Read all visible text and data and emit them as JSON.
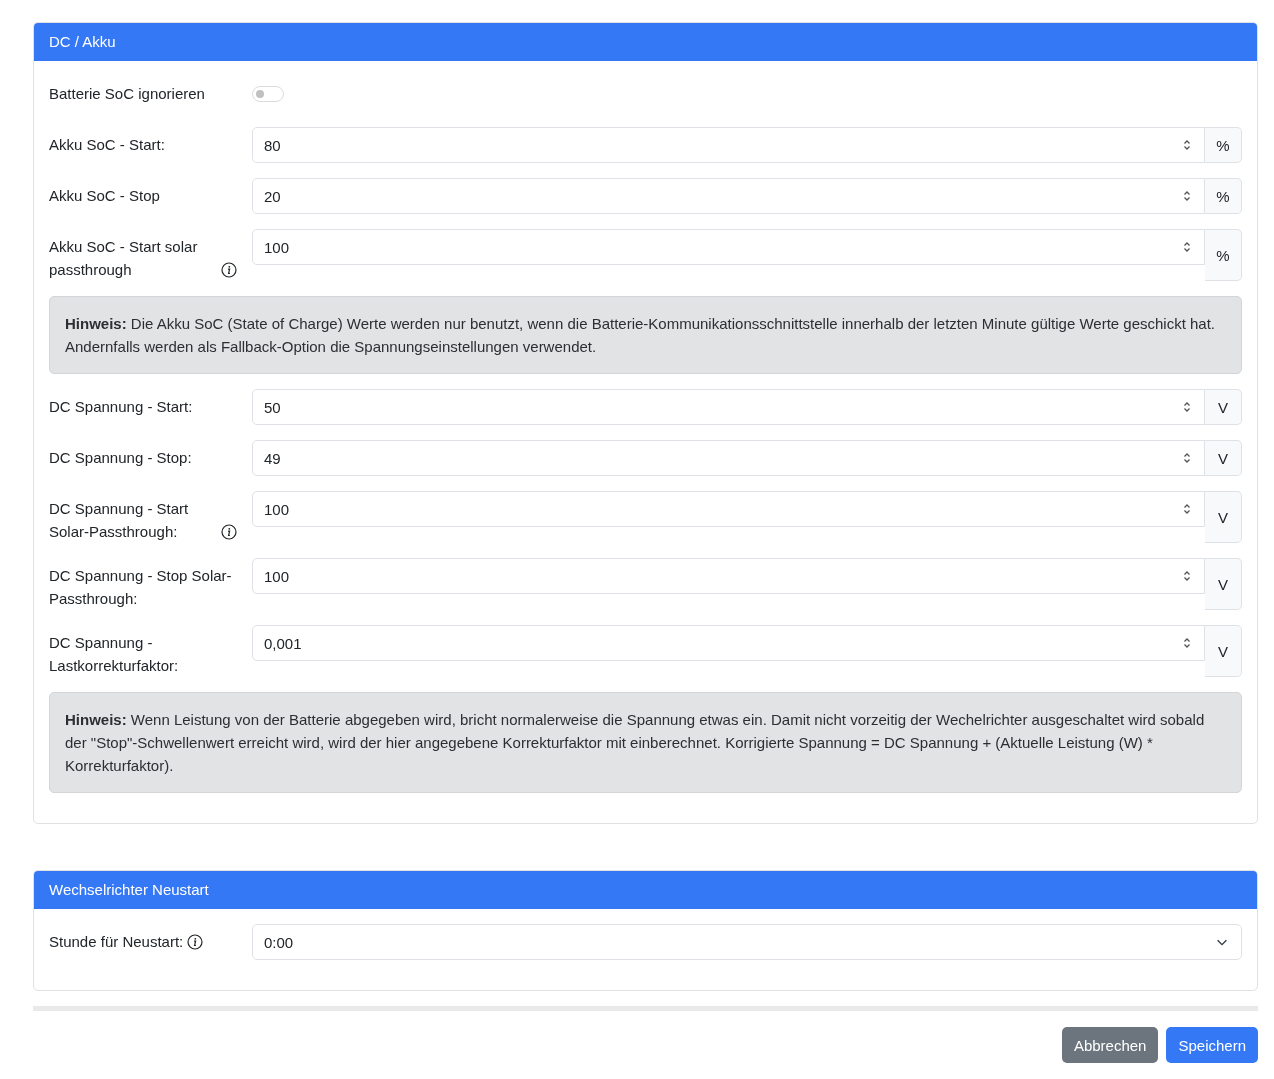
{
  "sections": [
    {
      "title": "DC / Akku",
      "rows": [
        {
          "kind": "toggle",
          "label": "Batterie SoC ignorieren",
          "on": false
        },
        {
          "kind": "number",
          "label": "Akku SoC - Start:",
          "value": "80",
          "unit": "%",
          "info": false
        },
        {
          "kind": "number",
          "label": "Akku SoC - Stop",
          "value": "20",
          "unit": "%",
          "info": false
        },
        {
          "kind": "number",
          "label": "Akku SoC - Start solar passthrough",
          "value": "100",
          "unit": "%",
          "info": true
        },
        {
          "kind": "note",
          "text": "**Hinweis:** Die Akku SoC (State of Charge) Werte werden nur benutzt, wenn die Batterie-Kommunikationsschnittstelle innerhalb der letzten Minute gültige Werte geschickt hat. Andernfalls werden als Fallback-Option die Spannungseinstellungen verwendet."
        },
        {
          "kind": "number",
          "label": "DC Spannung - Start:",
          "value": "50",
          "unit": "V",
          "info": false
        },
        {
          "kind": "number",
          "label": "DC Spannung - Stop:",
          "value": "49",
          "unit": "V",
          "info": false
        },
        {
          "kind": "number",
          "label": "DC Spannung - Start Solar-Passthrough:",
          "value": "100",
          "unit": "V",
          "info": true
        },
        {
          "kind": "number",
          "label": "DC Spannung - Stop Solar-Passthrough:",
          "value": "100",
          "unit": "V",
          "info": false
        },
        {
          "kind": "number",
          "label": "DC Spannung - Lastkorrekturfaktor:",
          "value": "0,001",
          "unit": "V",
          "info": false
        },
        {
          "kind": "note",
          "text": "**Hinweis:** Wenn Leistung von der Batterie abgegeben wird, bricht normalerweise die Spannung etwas ein. Damit nicht vorzeitig der Wechelrichter ausgeschaltet wird sobald der \"Stop\"-Schwellenwert erreicht wird, wird der hier angegebene Korrekturfaktor mit einberechnet. Korrigierte Spannung = DC Spannung + (Aktuelle Leistung (W) * Korrekturfaktor)."
        }
      ]
    },
    {
      "title": "Wechselrichter Neustart",
      "rows": [
        {
          "kind": "select",
          "label": "Stunde für Neustart:",
          "value": "0:00",
          "info": true
        }
      ]
    }
  ],
  "buttons": [
    {
      "label": "Abbrechen",
      "kind": "secondary"
    },
    {
      "label": "Speichern",
      "kind": "primary"
    }
  ]
}
